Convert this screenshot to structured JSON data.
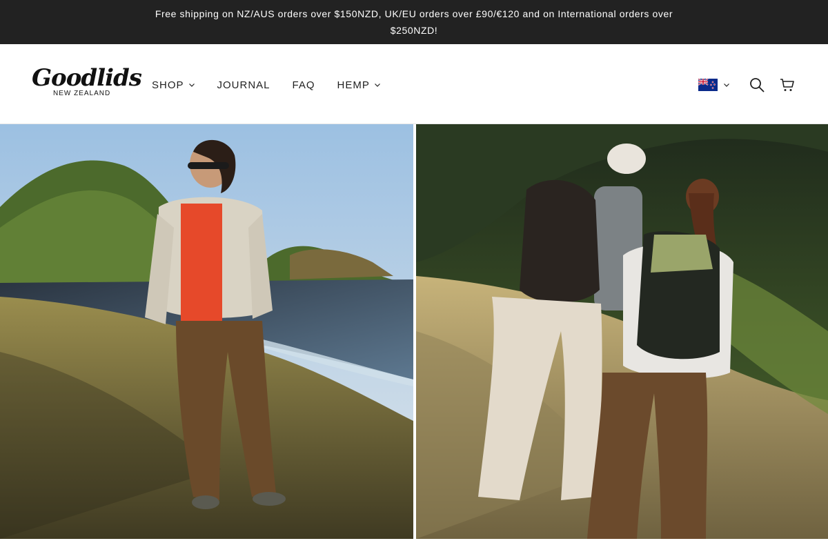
{
  "announcement": {
    "text": "Free shipping on NZ/AUS orders over $150NZD, UK/EU orders over £90/€120 and on International orders over $250NZD!"
  },
  "brand": {
    "name": "Goodlids",
    "subtitle": "NEW ZEALAND"
  },
  "nav": {
    "items": [
      {
        "label": "SHOP",
        "dropdown": true
      },
      {
        "label": "JOURNAL",
        "dropdown": false
      },
      {
        "label": "FAQ",
        "dropdown": false
      },
      {
        "label": "HEMP",
        "dropdown": true
      }
    ]
  },
  "header_tools": {
    "country_flag_icon": "new-zealand-flag-icon",
    "search_icon": "search-icon",
    "cart_icon": "cart-icon"
  },
  "hero": {
    "panels": [
      {
        "subject": "hero-image-left"
      },
      {
        "subject": "hero-image-right"
      }
    ]
  },
  "colors": {
    "announcement_bg": "#222222",
    "header_bg": "#ffffff",
    "text": "#1f1f1f",
    "flag_blue": "#0a2a8a",
    "flag_red": "#c8102e"
  }
}
